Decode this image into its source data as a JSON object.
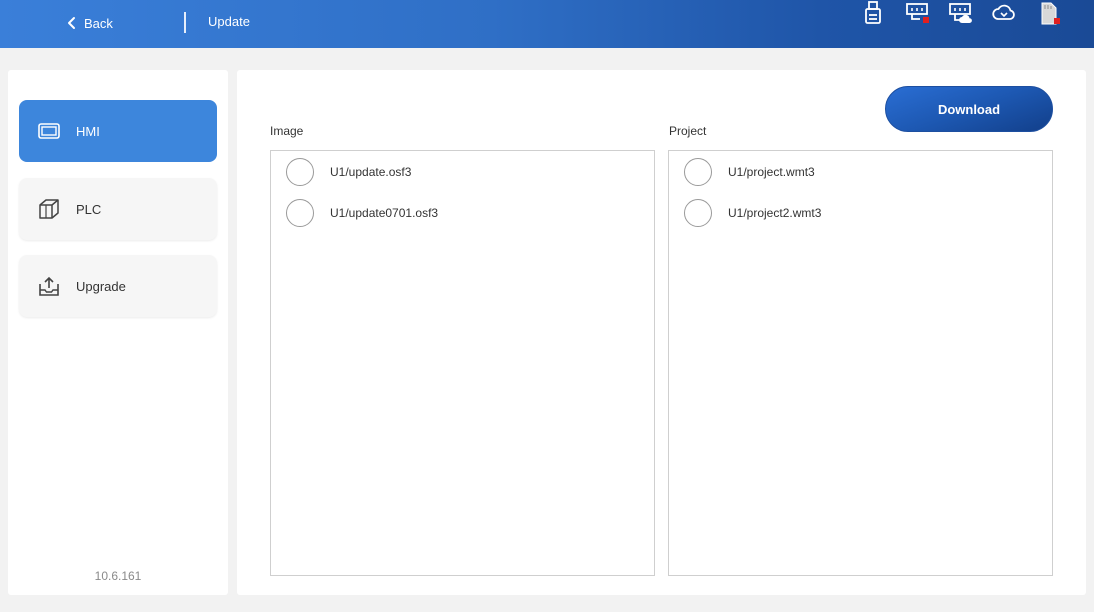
{
  "header": {
    "back_label": "Back",
    "title": "Update",
    "status_icons": [
      {
        "name": "usb-drive-icon"
      },
      {
        "name": "ethernet-port-icon",
        "status": "error"
      },
      {
        "name": "network-cloud-icon"
      },
      {
        "name": "cloud-sync-icon"
      },
      {
        "name": "sd-card-icon",
        "status": "error"
      }
    ]
  },
  "sidebar": {
    "items": [
      {
        "label": "HMI",
        "icon": "monitor-icon",
        "active": true
      },
      {
        "label": "PLC",
        "icon": "cube-icon",
        "active": false
      },
      {
        "label": "Upgrade",
        "icon": "upload-tray-icon",
        "active": false
      }
    ],
    "version": "10.6.161"
  },
  "main": {
    "download_label": "Download",
    "image": {
      "label": "Image",
      "files": [
        "U1/update.osf3",
        "U1/update0701.osf3"
      ]
    },
    "project": {
      "label": "Project",
      "files": [
        "U1/project.wmt3",
        "U1/project2.wmt3"
      ]
    }
  },
  "colors": {
    "accent": "#3d86dc",
    "header_start": "#3a7fd9",
    "header_end": "#1a4a96",
    "error_dot": "#e02020"
  }
}
